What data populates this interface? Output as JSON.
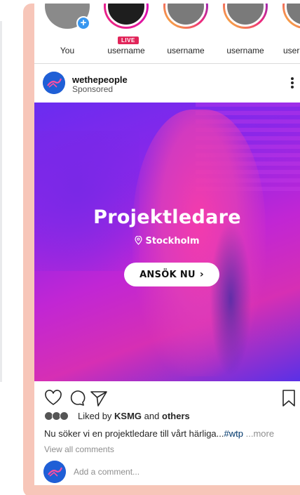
{
  "stories": [
    {
      "name": "You"
    },
    {
      "name": "username",
      "badge": "LIVE"
    },
    {
      "name": "username"
    },
    {
      "name": "username"
    },
    {
      "name": "user"
    }
  ],
  "post": {
    "account": "wethepeople",
    "sponsored": "Sponsored"
  },
  "ad": {
    "title": "Projektledare",
    "location": "Stockholm",
    "cta_label": "ANSÖK NU"
  },
  "likes": {
    "prefix": "Liked by",
    "first": "KSMG",
    "and": "and",
    "rest": "others"
  },
  "caption": {
    "text": "Nu söker vi en projektledare till vårt härliga...",
    "hashtag": "#wtp",
    "more": "...more"
  },
  "comments": {
    "view_all": "View all comments",
    "placeholder": "Add a comment..."
  },
  "colors": {
    "frame": "#f7c6b9",
    "cta_bg": "#ffffff",
    "live_badge": "#e1255a",
    "accent_blue": "#3897f0",
    "avatar_blue": "#1f5fd6"
  }
}
